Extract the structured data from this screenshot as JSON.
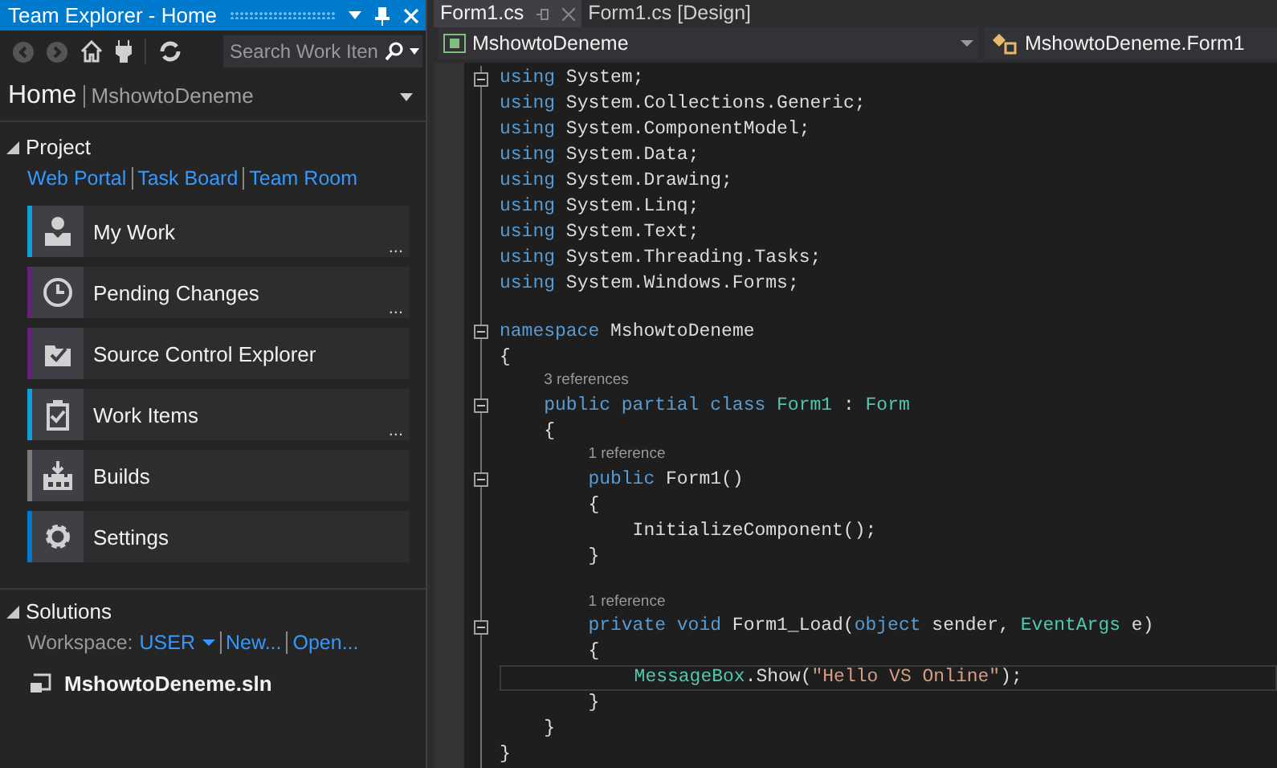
{
  "team_explorer": {
    "title": "Team Explorer - Home",
    "search": {
      "placeholder": "Search Work Iten"
    },
    "header": {
      "title": "Home",
      "project": "MshowtoDeneme"
    },
    "project_section": {
      "title": "Project",
      "expanded": true,
      "links": [
        "Web Portal",
        "Task Board",
        "Team Room"
      ]
    },
    "tiles": [
      {
        "label": "My Work",
        "kind": "my-work",
        "color": "#0e9ed8",
        "menu": "..."
      },
      {
        "label": "Pending Changes",
        "kind": "pending",
        "color": "#68217a",
        "menu": "..."
      },
      {
        "label": "Source Control Explorer",
        "kind": "source",
        "color": "#68217a"
      },
      {
        "label": "Work Items",
        "kind": "work-items",
        "color": "#0e9ed8",
        "menu": "..."
      },
      {
        "label": "Builds",
        "kind": "builds",
        "color": "#7a7a7a"
      },
      {
        "label": "Settings",
        "kind": "settings",
        "color": "#007acc"
      }
    ],
    "solutions_section": {
      "title": "Solutions",
      "expanded": true,
      "workspace_label": "Workspace:",
      "workspace": "USER",
      "links": [
        "New...",
        "Open..."
      ],
      "items": [
        "MshowtoDeneme.sln"
      ]
    }
  },
  "editor": {
    "tabs": [
      {
        "label": "Form1.cs",
        "selected": true
      },
      {
        "label": "Form1.cs [Design]",
        "selected": false
      }
    ],
    "project_dropdown": "MshowtoDeneme",
    "class_dropdown": "MshowtoDeneme.Form1",
    "lines": [
      {
        "kind": "code",
        "fold": true,
        "tokens": [
          {
            "kind": "keyword",
            "text": "using"
          },
          {
            "kind": "plain",
            "text": " System;"
          }
        ]
      },
      {
        "kind": "code",
        "tokens": [
          {
            "kind": "keyword",
            "text": "using"
          },
          {
            "kind": "plain",
            "text": " System.Collections.Generic;"
          }
        ]
      },
      {
        "kind": "code",
        "tokens": [
          {
            "kind": "keyword",
            "text": "using"
          },
          {
            "kind": "plain",
            "text": " System.ComponentModel;"
          }
        ]
      },
      {
        "kind": "code",
        "tokens": [
          {
            "kind": "keyword",
            "text": "using"
          },
          {
            "kind": "plain",
            "text": " System.Data;"
          }
        ]
      },
      {
        "kind": "code",
        "tokens": [
          {
            "kind": "keyword",
            "text": "using"
          },
          {
            "kind": "plain",
            "text": " System.Drawing;"
          }
        ]
      },
      {
        "kind": "code",
        "tokens": [
          {
            "kind": "keyword",
            "text": "using"
          },
          {
            "kind": "plain",
            "text": " System.Linq;"
          }
        ]
      },
      {
        "kind": "code",
        "tokens": [
          {
            "kind": "keyword",
            "text": "using"
          },
          {
            "kind": "plain",
            "text": " System.Text;"
          }
        ]
      },
      {
        "kind": "code",
        "tokens": [
          {
            "kind": "keyword",
            "text": "using"
          },
          {
            "kind": "plain",
            "text": " System.Threading.Tasks;"
          }
        ]
      },
      {
        "kind": "code",
        "tokens": [
          {
            "kind": "keyword",
            "text": "using"
          },
          {
            "kind": "plain",
            "text": " System.Windows.Forms;"
          }
        ]
      },
      {
        "kind": "blank"
      },
      {
        "kind": "code",
        "fold": true,
        "tokens": [
          {
            "kind": "keyword",
            "text": "namespace"
          },
          {
            "kind": "plain",
            "text": " MshowtoDeneme"
          }
        ]
      },
      {
        "kind": "code",
        "tokens": [
          {
            "kind": "plain",
            "text": "{"
          }
        ]
      },
      {
        "kind": "block",
        "children": [
          {
            "kind": "codelens",
            "text": "3 references"
          },
          {
            "kind": "code",
            "fold": true,
            "tokens": [
              {
                "kind": "keyword",
                "text": "public partial class"
              },
              {
                "kind": "type",
                "text": " Form1"
              },
              {
                "kind": "plain",
                "text": " : "
              },
              {
                "kind": "type",
                "text": "Form"
              }
            ]
          },
          {
            "kind": "code",
            "tokens": [
              {
                "kind": "plain",
                "text": "{"
              }
            ]
          },
          {
            "kind": "block",
            "children": [
              {
                "kind": "codelens",
                "text": "1 reference"
              },
              {
                "kind": "code",
                "fold": true,
                "tokens": [
                  {
                    "kind": "keyword",
                    "text": "public"
                  },
                  {
                    "kind": "plain",
                    "text": " Form1()"
                  }
                ]
              },
              {
                "kind": "code",
                "tokens": [
                  {
                    "kind": "plain",
                    "text": "{"
                  }
                ]
              },
              {
                "kind": "block",
                "children": [
                  {
                    "kind": "code",
                    "tokens": [
                      {
                        "kind": "plain",
                        "text": "InitializeComponent();"
                      }
                    ]
                  }
                ]
              },
              {
                "kind": "code",
                "tokens": [
                  {
                    "kind": "plain",
                    "text": "}"
                  }
                ]
              },
              {
                "kind": "blank"
              },
              {
                "kind": "codelens",
                "text": "1 reference"
              },
              {
                "kind": "code",
                "fold": true,
                "tokens": [
                  {
                    "kind": "keyword",
                    "text": "private void"
                  },
                  {
                    "kind": "plain",
                    "text": " Form1_Load("
                  },
                  {
                    "kind": "keyword",
                    "text": "object"
                  },
                  {
                    "kind": "plain",
                    "text": " sender, "
                  },
                  {
                    "kind": "type",
                    "text": "EventArgs"
                  },
                  {
                    "kind": "plain",
                    "text": " e)"
                  }
                ]
              },
              {
                "kind": "code",
                "tokens": [
                  {
                    "kind": "plain",
                    "text": "{"
                  }
                ]
              },
              {
                "kind": "block",
                "children": [
                  {
                    "kind": "code",
                    "current": true,
                    "tokens": [
                      {
                        "kind": "type",
                        "text": "MessageBox"
                      },
                      {
                        "kind": "plain",
                        "text": ".Show("
                      },
                      {
                        "kind": "string",
                        "text": "\"Hello VS Online\""
                      },
                      {
                        "kind": "plain",
                        "text": ");"
                      }
                    ]
                  }
                ]
              },
              {
                "kind": "code",
                "tokens": [
                  {
                    "kind": "plain",
                    "text": "}"
                  }
                ]
              }
            ]
          },
          {
            "kind": "code",
            "tokens": [
              {
                "kind": "plain",
                "text": "}"
              }
            ]
          }
        ]
      },
      {
        "kind": "code",
        "tokens": [
          {
            "kind": "plain",
            "text": "}"
          }
        ]
      }
    ]
  }
}
